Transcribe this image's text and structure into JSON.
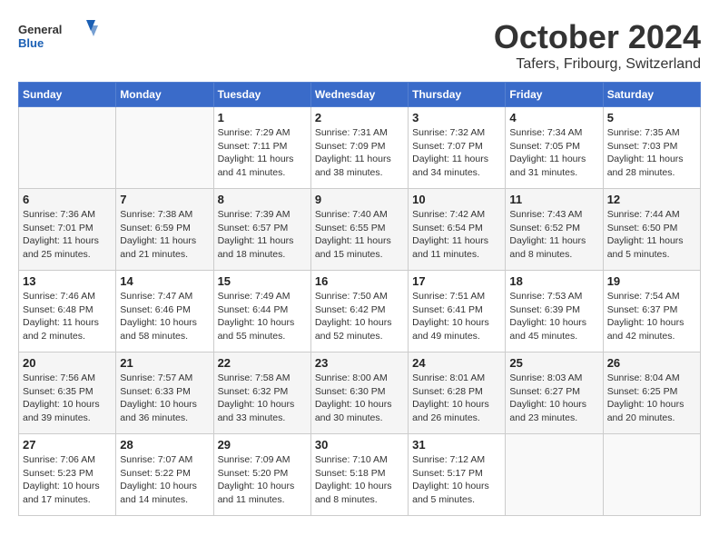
{
  "header": {
    "logo_general": "General",
    "logo_blue": "Blue",
    "month": "October 2024",
    "location": "Tafers, Fribourg, Switzerland"
  },
  "weekdays": [
    "Sunday",
    "Monday",
    "Tuesday",
    "Wednesday",
    "Thursday",
    "Friday",
    "Saturday"
  ],
  "weeks": [
    [
      {
        "day": "",
        "info": ""
      },
      {
        "day": "",
        "info": ""
      },
      {
        "day": "1",
        "info": "Sunrise: 7:29 AM\nSunset: 7:11 PM\nDaylight: 11 hours and 41 minutes."
      },
      {
        "day": "2",
        "info": "Sunrise: 7:31 AM\nSunset: 7:09 PM\nDaylight: 11 hours and 38 minutes."
      },
      {
        "day": "3",
        "info": "Sunrise: 7:32 AM\nSunset: 7:07 PM\nDaylight: 11 hours and 34 minutes."
      },
      {
        "day": "4",
        "info": "Sunrise: 7:34 AM\nSunset: 7:05 PM\nDaylight: 11 hours and 31 minutes."
      },
      {
        "day": "5",
        "info": "Sunrise: 7:35 AM\nSunset: 7:03 PM\nDaylight: 11 hours and 28 minutes."
      }
    ],
    [
      {
        "day": "6",
        "info": "Sunrise: 7:36 AM\nSunset: 7:01 PM\nDaylight: 11 hours and 25 minutes."
      },
      {
        "day": "7",
        "info": "Sunrise: 7:38 AM\nSunset: 6:59 PM\nDaylight: 11 hours and 21 minutes."
      },
      {
        "day": "8",
        "info": "Sunrise: 7:39 AM\nSunset: 6:57 PM\nDaylight: 11 hours and 18 minutes."
      },
      {
        "day": "9",
        "info": "Sunrise: 7:40 AM\nSunset: 6:55 PM\nDaylight: 11 hours and 15 minutes."
      },
      {
        "day": "10",
        "info": "Sunrise: 7:42 AM\nSunset: 6:54 PM\nDaylight: 11 hours and 11 minutes."
      },
      {
        "day": "11",
        "info": "Sunrise: 7:43 AM\nSunset: 6:52 PM\nDaylight: 11 hours and 8 minutes."
      },
      {
        "day": "12",
        "info": "Sunrise: 7:44 AM\nSunset: 6:50 PM\nDaylight: 11 hours and 5 minutes."
      }
    ],
    [
      {
        "day": "13",
        "info": "Sunrise: 7:46 AM\nSunset: 6:48 PM\nDaylight: 11 hours and 2 minutes."
      },
      {
        "day": "14",
        "info": "Sunrise: 7:47 AM\nSunset: 6:46 PM\nDaylight: 10 hours and 58 minutes."
      },
      {
        "day": "15",
        "info": "Sunrise: 7:49 AM\nSunset: 6:44 PM\nDaylight: 10 hours and 55 minutes."
      },
      {
        "day": "16",
        "info": "Sunrise: 7:50 AM\nSunset: 6:42 PM\nDaylight: 10 hours and 52 minutes."
      },
      {
        "day": "17",
        "info": "Sunrise: 7:51 AM\nSunset: 6:41 PM\nDaylight: 10 hours and 49 minutes."
      },
      {
        "day": "18",
        "info": "Sunrise: 7:53 AM\nSunset: 6:39 PM\nDaylight: 10 hours and 45 minutes."
      },
      {
        "day": "19",
        "info": "Sunrise: 7:54 AM\nSunset: 6:37 PM\nDaylight: 10 hours and 42 minutes."
      }
    ],
    [
      {
        "day": "20",
        "info": "Sunrise: 7:56 AM\nSunset: 6:35 PM\nDaylight: 10 hours and 39 minutes."
      },
      {
        "day": "21",
        "info": "Sunrise: 7:57 AM\nSunset: 6:33 PM\nDaylight: 10 hours and 36 minutes."
      },
      {
        "day": "22",
        "info": "Sunrise: 7:58 AM\nSunset: 6:32 PM\nDaylight: 10 hours and 33 minutes."
      },
      {
        "day": "23",
        "info": "Sunrise: 8:00 AM\nSunset: 6:30 PM\nDaylight: 10 hours and 30 minutes."
      },
      {
        "day": "24",
        "info": "Sunrise: 8:01 AM\nSunset: 6:28 PM\nDaylight: 10 hours and 26 minutes."
      },
      {
        "day": "25",
        "info": "Sunrise: 8:03 AM\nSunset: 6:27 PM\nDaylight: 10 hours and 23 minutes."
      },
      {
        "day": "26",
        "info": "Sunrise: 8:04 AM\nSunset: 6:25 PM\nDaylight: 10 hours and 20 minutes."
      }
    ],
    [
      {
        "day": "27",
        "info": "Sunrise: 7:06 AM\nSunset: 5:23 PM\nDaylight: 10 hours and 17 minutes."
      },
      {
        "day": "28",
        "info": "Sunrise: 7:07 AM\nSunset: 5:22 PM\nDaylight: 10 hours and 14 minutes."
      },
      {
        "day": "29",
        "info": "Sunrise: 7:09 AM\nSunset: 5:20 PM\nDaylight: 10 hours and 11 minutes."
      },
      {
        "day": "30",
        "info": "Sunrise: 7:10 AM\nSunset: 5:18 PM\nDaylight: 10 hours and 8 minutes."
      },
      {
        "day": "31",
        "info": "Sunrise: 7:12 AM\nSunset: 5:17 PM\nDaylight: 10 hours and 5 minutes."
      },
      {
        "day": "",
        "info": ""
      },
      {
        "day": "",
        "info": ""
      }
    ]
  ]
}
